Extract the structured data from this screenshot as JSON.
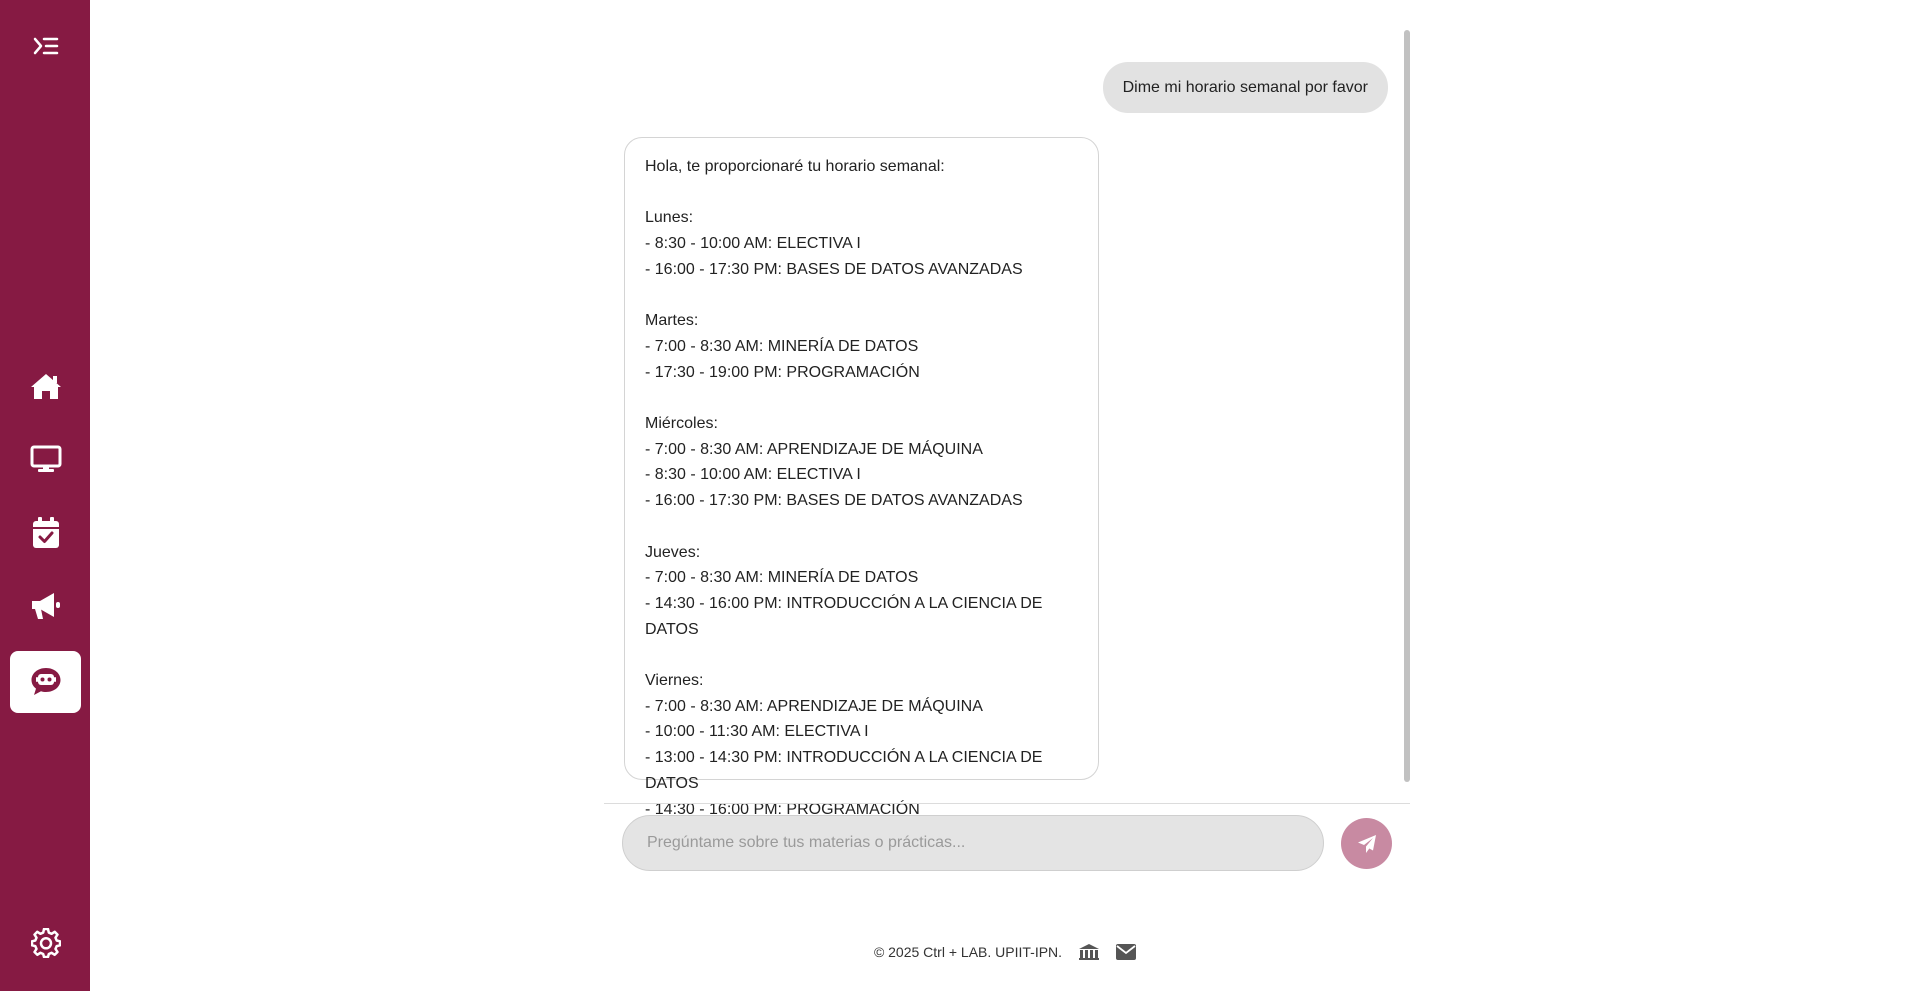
{
  "sidebar": {
    "items": [
      {
        "icon": "menu-toggle-icon",
        "active": false
      },
      {
        "icon": "home-icon",
        "active": false
      },
      {
        "icon": "monitor-icon",
        "active": false
      },
      {
        "icon": "calendar-check-icon",
        "active": false
      },
      {
        "icon": "megaphone-icon",
        "active": false
      },
      {
        "icon": "chatbot-icon",
        "active": true
      },
      {
        "icon": "gear-icon",
        "active": false
      }
    ]
  },
  "chat": {
    "user_message": "Dime mi horario semanal por favor",
    "bot_message": "Hola, te proporcionaré tu horario semanal:\n\nLunes:\n- 8:30 - 10:00 AM: ELECTIVA I\n- 16:00 - 17:30 PM: BASES DE DATOS AVANZADAS\n\nMartes:\n- 7:00 - 8:30 AM: MINERÍA DE DATOS\n- 17:30 - 19:00 PM: PROGRAMACIÓN\n\nMiércoles:\n- 7:00 - 8:30 AM: APRENDIZAJE DE MÁQUINA\n- 8:30 - 10:00 AM: ELECTIVA I\n- 16:00 - 17:30 PM: BASES DE DATOS AVANZADAS\n\nJueves:\n- 7:00 - 8:30 AM: MINERÍA DE DATOS\n- 14:30 - 16:00 PM: INTRODUCCIÓN A LA CIENCIA DE DATOS\n\nViernes:\n- 7:00 - 8:30 AM: APRENDIZAJE DE MÁQUINA\n- 10:00 - 11:30 AM: ELECTIVA I\n- 13:00 - 14:30 PM: INTRODUCCIÓN A LA CIENCIA DE DATOS\n- 14:30 - 16:00 PM: PROGRAMACIÓN",
    "input_value": "",
    "input_placeholder": "Pregúntame sobre tus materias o prácticas...",
    "send_icon": "paper-plane-icon"
  },
  "footer": {
    "text": "© 2025 Ctrl + LAB. UPIIT-IPN.",
    "icons": [
      "institution-icon",
      "envelope-icon"
    ]
  },
  "colors": {
    "sidebar_bg": "#861a43",
    "active_bg": "#ffffff",
    "send_button": "#c88aa2",
    "user_bubble": "#e2e2e2"
  }
}
